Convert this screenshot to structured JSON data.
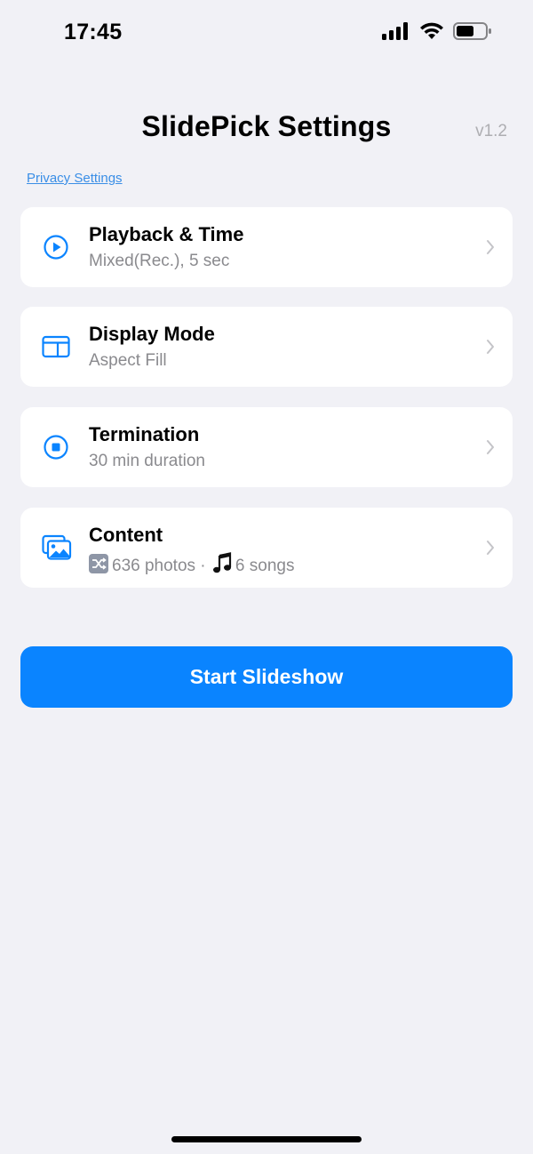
{
  "status_bar": {
    "time": "17:45",
    "icons": [
      "cellular-signal-icon",
      "wifi-icon",
      "battery-icon"
    ]
  },
  "header": {
    "title": "SlidePick Settings",
    "version": "v1.2",
    "privacy_link": "Privacy Settings"
  },
  "settings": [
    {
      "title": "Playback & Time",
      "subtitle": "Mixed(Rec.), 5 sec",
      "icon": "play-circle-icon"
    },
    {
      "title": "Display Mode",
      "subtitle": "Aspect Fill",
      "icon": "display-mode-icon"
    },
    {
      "title": "Termination",
      "subtitle": "30 min duration",
      "icon": "stop-circle-icon"
    },
    {
      "title": "Content",
      "photos_text": "636 photos · ",
      "songs_text": "6 songs",
      "icon": "photos-icon"
    }
  ],
  "actions": {
    "start_label": "Start Slideshow"
  },
  "colors": {
    "accent": "#0A84FF",
    "background": "#F1F1F6",
    "card": "#FFFFFF",
    "subtitle": "#8A8A8E",
    "link": "#3A8EE6"
  }
}
